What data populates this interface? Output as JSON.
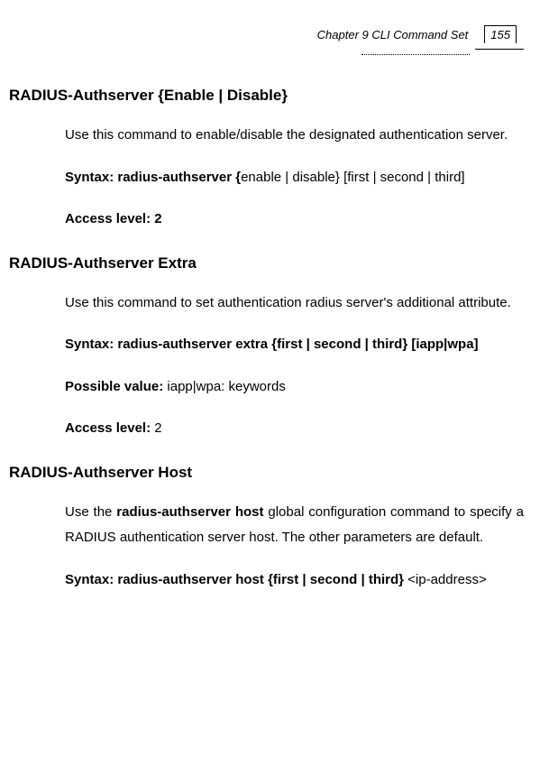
{
  "header": {
    "chapter": "Chapter 9 CLI Command Set",
    "page": "155"
  },
  "sections": [
    {
      "title": "RADIUS-Authserver {Enable | Disable}",
      "desc": {
        "prefix": "",
        "bold": "",
        "rest": "Use this command to enable/disable the designated authentication server."
      },
      "syntax": {
        "label": "Syntax: radius-authserver {",
        "rest": "enable | disable} [first | second | third]"
      },
      "extra_bold_line": "",
      "possible": {
        "label": "",
        "rest": ""
      },
      "access": {
        "label": "Access level: 2",
        "rest": ""
      }
    },
    {
      "title": "RADIUS-Authserver Extra",
      "desc": {
        "prefix": "",
        "bold": "",
        "rest": "Use this command to set authentication radius server's additional attribute."
      },
      "syntax": {
        "label": "Syntax: radius-authserver extra {first | second | third} [iapp|wpa]",
        "rest": ""
      },
      "extra_bold_line": "",
      "possible": {
        "label": "Possible value: ",
        "rest": "iapp|wpa: keywords"
      },
      "access": {
        "label": "Access level: ",
        "rest": "2"
      }
    },
    {
      "title": "RADIUS-Authserver Host",
      "desc": {
        "prefix": "Use the ",
        "bold": "radius-authserver host",
        "rest": " global configuration command to specify a RADIUS authentication server host. The other parameters are default."
      },
      "syntax": {
        "label": "Syntax: radius-authserver host {first | second | third} ",
        "rest": "<ip-address>"
      },
      "extra_bold_line": "",
      "possible": {
        "label": "",
        "rest": ""
      },
      "access": {
        "label": "",
        "rest": ""
      }
    }
  ]
}
